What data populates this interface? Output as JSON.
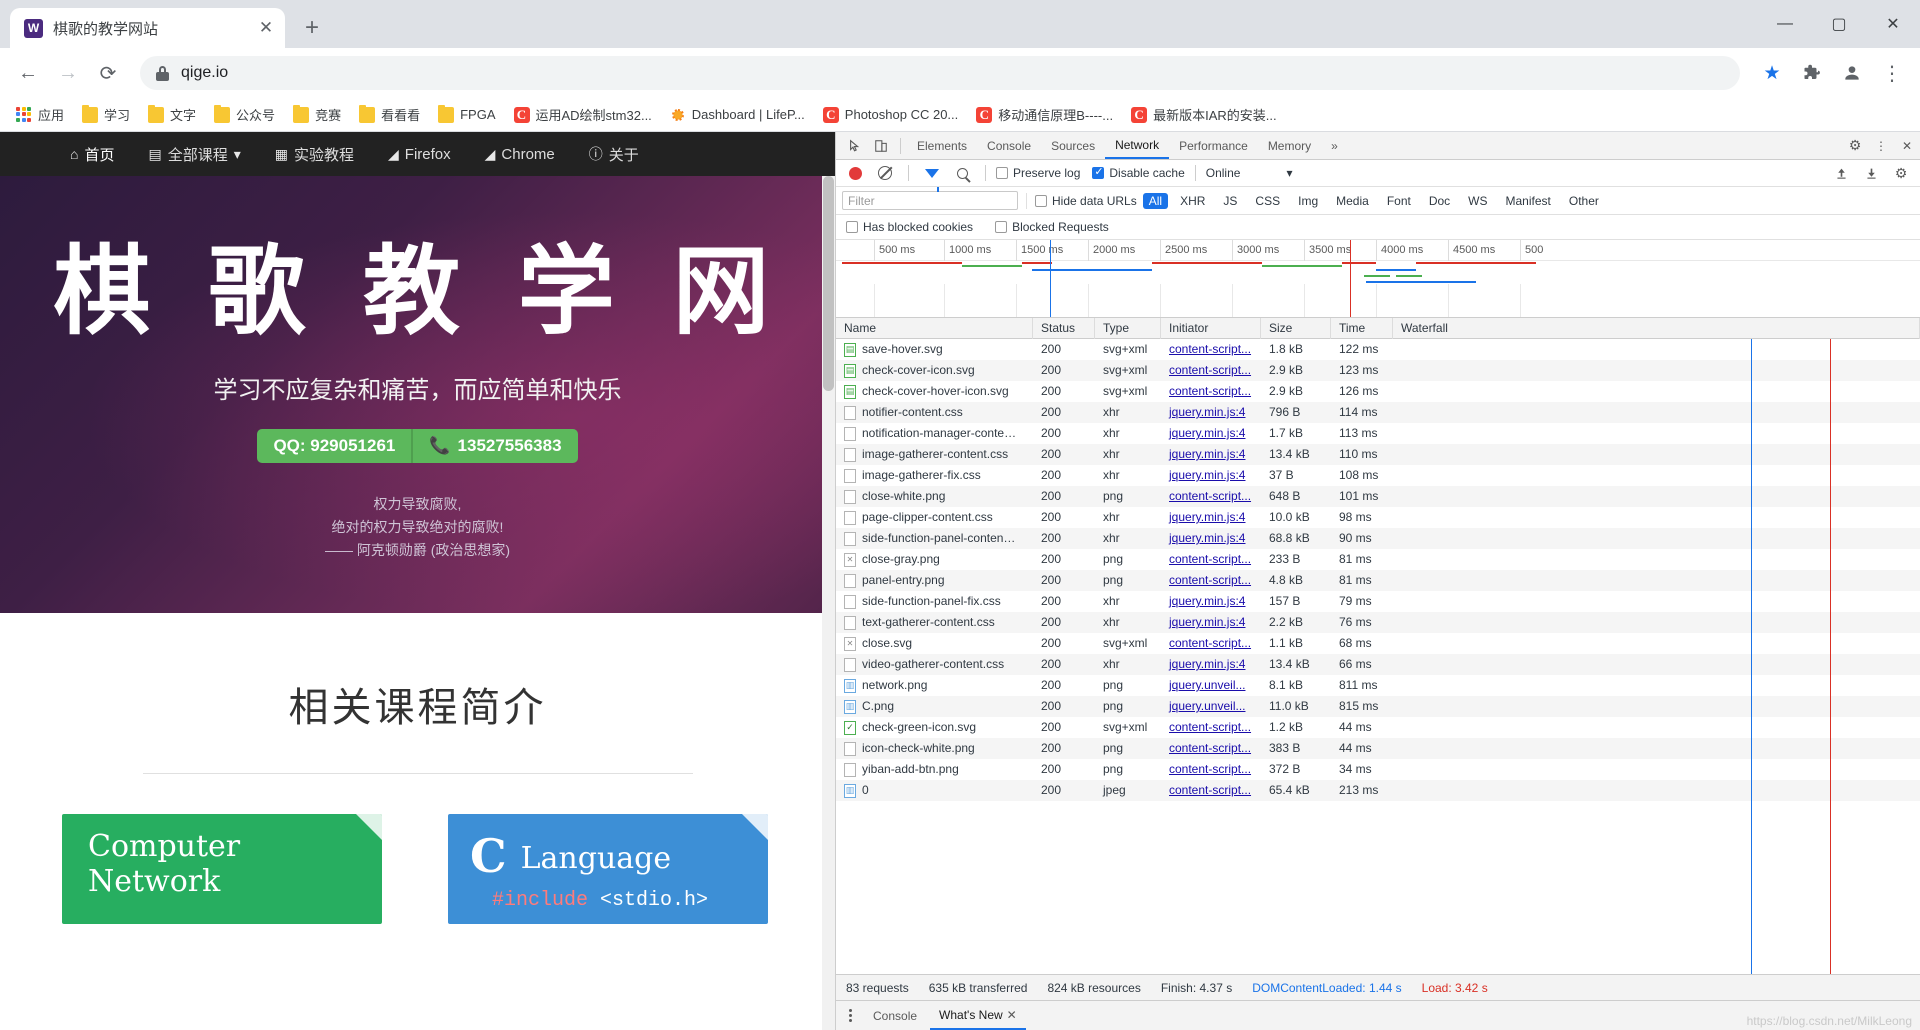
{
  "browser": {
    "tab": {
      "title": "棋歌的教学网站",
      "favicon_letter": "W",
      "close_label": "✕"
    },
    "newtab_label": "+",
    "window_controls": {
      "minimize": "—",
      "maximize": "▢",
      "close": "✕"
    },
    "nav": {
      "back": "←",
      "forward": "→",
      "reload": "⟳"
    },
    "omnibox": {
      "url": "qige.io",
      "lock_icon": "lock-icon",
      "star_icon": "bookmark-star-icon"
    },
    "toolbar_right": {
      "extensions": "🧩",
      "profile": "avatar",
      "menu": "⋮"
    },
    "bookmarks": [
      {
        "label": "应用",
        "icon": "apps-grid-icon"
      },
      {
        "label": "学习",
        "icon": "folder-icon"
      },
      {
        "label": "文字",
        "icon": "folder-icon"
      },
      {
        "label": "公众号",
        "icon": "folder-icon"
      },
      {
        "label": "竞赛",
        "icon": "folder-icon"
      },
      {
        "label": "看看看",
        "icon": "folder-icon"
      },
      {
        "label": "FPGA",
        "icon": "folder-icon"
      },
      {
        "label": "运用AD绘制stm32...",
        "icon": "csdn-icon"
      },
      {
        "label": "Dashboard | LifeP...",
        "icon": "sun-icon"
      },
      {
        "label": "Photoshop CC 20...",
        "icon": "csdn-icon"
      },
      {
        "label": "移动通信原理B----...",
        "icon": "csdn-icon"
      },
      {
        "label": "最新版本IAR的安装...",
        "icon": "csdn-icon"
      }
    ]
  },
  "site": {
    "nav": [
      {
        "label": "首页",
        "icon": "home-icon"
      },
      {
        "label": "全部课程",
        "icon": "book-icon",
        "caret": "▾"
      },
      {
        "label": "实验教程",
        "icon": "grid-icon"
      },
      {
        "label": "Firefox",
        "icon": "firefox-icon"
      },
      {
        "label": "Chrome",
        "icon": "chrome-icon"
      },
      {
        "label": "关于",
        "icon": "info-icon"
      }
    ],
    "hero": {
      "title": "棋 歌 教 学 网",
      "subtitle": "学习不应复杂和痛苦，而应简单和快乐",
      "qq_badge": "QQ: 929051261",
      "phone_badge": "13527556383",
      "phone_icon": "phone-icon",
      "quote_line1": "权力导致腐败,",
      "quote_line2": "绝对的权力导致绝对的腐败!",
      "quote_author": "—— 阿克顿勋爵 (政治思想家)"
    },
    "section_title": "相关课程简介",
    "cards": [
      {
        "line1": "Computer",
        "line2": "Network",
        "color": "#27ae60"
      },
      {
        "letter": "C",
        "title": "Language",
        "code_kw": "#include",
        "code_rest": " <stdio.h>",
        "color": "#3d8fd6"
      }
    ]
  },
  "devtools": {
    "tabs": [
      {
        "label": "Elements",
        "active": false
      },
      {
        "label": "Console",
        "active": false
      },
      {
        "label": "Sources",
        "active": false
      },
      {
        "label": "Network",
        "active": true
      },
      {
        "label": "Performance",
        "active": false
      },
      {
        "label": "Memory",
        "active": false
      }
    ],
    "more_label": "»",
    "icons": {
      "inspect": "inspect-element-icon",
      "device": "device-toolbar-icon",
      "settings": "gear-icon",
      "kebab": "more-options-icon",
      "close": "close-icon"
    },
    "toolbar": {
      "record_label": "record-button",
      "clear_label": "clear-button",
      "filter_toggle": "filter-icon",
      "search_toggle": "search-icon",
      "preserve_log": "Preserve log",
      "preserve_log_checked": false,
      "disable_cache": "Disable cache",
      "disable_cache_checked": true,
      "throttle_value": "Online",
      "throttle_caret": "▾",
      "import_icon": "import-har-icon",
      "export_icon": "export-har-icon"
    },
    "filterbar": {
      "filter_placeholder": "Filter",
      "hide_data_urls": "Hide data URLs",
      "hide_data_urls_checked": false,
      "types": [
        "All",
        "XHR",
        "JS",
        "CSS",
        "Img",
        "Media",
        "Font",
        "Doc",
        "WS",
        "Manifest",
        "Other"
      ],
      "active_type": "All"
    },
    "blockedbar": {
      "has_blocked_cookies": "Has blocked cookies",
      "has_blocked_cookies_checked": false,
      "blocked_requests": "Blocked Requests",
      "blocked_requests_checked": false
    },
    "overview_ticks": [
      "500 ms",
      "1000 ms",
      "1500 ms",
      "2000 ms",
      "2500 ms",
      "3000 ms",
      "3500 ms",
      "4000 ms",
      "4500 ms",
      "500"
    ],
    "columns": [
      "Name",
      "Status",
      "Type",
      "Initiator",
      "Size",
      "Time",
      "Waterfall"
    ],
    "rows": [
      {
        "name": "save-hover.svg",
        "icon": "svg-file-icon",
        "status": "200",
        "type": "svg+xml",
        "initiator": "content-script...",
        "size": "1.8 kB",
        "time": "122 ms"
      },
      {
        "name": "check-cover-icon.svg",
        "icon": "svg-file-icon",
        "status": "200",
        "type": "svg+xml",
        "initiator": "content-script...",
        "size": "2.9 kB",
        "time": "123 ms"
      },
      {
        "name": "check-cover-hover-icon.svg",
        "icon": "svg-file-icon",
        "status": "200",
        "type": "svg+xml",
        "initiator": "content-script...",
        "size": "2.9 kB",
        "time": "126 ms"
      },
      {
        "name": "notifier-content.css",
        "icon": "file-icon",
        "status": "200",
        "type": "xhr",
        "initiator": "jquery.min.js:4",
        "size": "796 B",
        "time": "114 ms"
      },
      {
        "name": "notification-manager-conte…",
        "icon": "file-icon",
        "status": "200",
        "type": "xhr",
        "initiator": "jquery.min.js:4",
        "size": "1.7 kB",
        "time": "113 ms"
      },
      {
        "name": "image-gatherer-content.css",
        "icon": "file-icon",
        "status": "200",
        "type": "xhr",
        "initiator": "jquery.min.js:4",
        "size": "13.4 kB",
        "time": "110 ms"
      },
      {
        "name": "image-gatherer-fix.css",
        "icon": "file-icon",
        "status": "200",
        "type": "xhr",
        "initiator": "jquery.min.js:4",
        "size": "37 B",
        "time": "108 ms"
      },
      {
        "name": "close-white.png",
        "icon": "file-icon",
        "status": "200",
        "type": "png",
        "initiator": "content-script...",
        "size": "648 B",
        "time": "101 ms"
      },
      {
        "name": "page-clipper-content.css",
        "icon": "file-icon",
        "status": "200",
        "type": "xhr",
        "initiator": "jquery.min.js:4",
        "size": "10.0 kB",
        "time": "98 ms"
      },
      {
        "name": "side-function-panel-conten…",
        "icon": "file-icon",
        "status": "200",
        "type": "xhr",
        "initiator": "jquery.min.js:4",
        "size": "68.8 kB",
        "time": "90 ms"
      },
      {
        "name": "close-gray.png",
        "icon": "image-broken-icon",
        "status": "200",
        "type": "png",
        "initiator": "content-script...",
        "size": "233 B",
        "time": "81 ms"
      },
      {
        "name": "panel-entry.png",
        "icon": "file-icon",
        "status": "200",
        "type": "png",
        "initiator": "content-script...",
        "size": "4.8 kB",
        "time": "81 ms"
      },
      {
        "name": "side-function-panel-fix.css",
        "icon": "file-icon",
        "status": "200",
        "type": "xhr",
        "initiator": "jquery.min.js:4",
        "size": "157 B",
        "time": "79 ms"
      },
      {
        "name": "text-gatherer-content.css",
        "icon": "file-icon",
        "status": "200",
        "type": "xhr",
        "initiator": "jquery.min.js:4",
        "size": "2.2 kB",
        "time": "76 ms"
      },
      {
        "name": "close.svg",
        "icon": "image-broken-icon",
        "status": "200",
        "type": "svg+xml",
        "initiator": "content-script...",
        "size": "1.1 kB",
        "time": "68 ms"
      },
      {
        "name": "video-gatherer-content.css",
        "icon": "file-icon",
        "status": "200",
        "type": "xhr",
        "initiator": "jquery.min.js:4",
        "size": "13.4 kB",
        "time": "66 ms"
      },
      {
        "name": "network.png",
        "icon": "image-file-icon",
        "status": "200",
        "type": "png",
        "initiator": "jquery.unveil...",
        "size": "8.1 kB",
        "time": "811 ms"
      },
      {
        "name": "C.png",
        "icon": "image-file-icon",
        "status": "200",
        "type": "png",
        "initiator": "jquery.unveil...",
        "size": "11.0 kB",
        "time": "815 ms"
      },
      {
        "name": "check-green-icon.svg",
        "icon": "check-green-icon",
        "status": "200",
        "type": "svg+xml",
        "initiator": "content-script...",
        "size": "1.2 kB",
        "time": "44 ms"
      },
      {
        "name": "icon-check-white.png",
        "icon": "file-icon",
        "status": "200",
        "type": "png",
        "initiator": "content-script...",
        "size": "383 B",
        "time": "44 ms"
      },
      {
        "name": "yiban-add-btn.png",
        "icon": "file-icon",
        "status": "200",
        "type": "png",
        "initiator": "content-script...",
        "size": "372 B",
        "time": "34 ms"
      },
      {
        "name": "0",
        "icon": "image-file-icon",
        "status": "200",
        "type": "jpeg",
        "initiator": "content-script...",
        "size": "65.4 kB",
        "time": "213 ms"
      }
    ],
    "status": {
      "requests": "83 requests",
      "transferred": "635 kB transferred",
      "resources": "824 kB resources",
      "finish": "Finish: 4.37 s",
      "dom_loaded": "DOMContentLoaded: 1.44 s",
      "load": "Load: 3.42 s"
    },
    "drawer": {
      "tabs": [
        {
          "label": "Console",
          "active": false
        },
        {
          "label": "What's New",
          "active": true
        }
      ],
      "close": "✕",
      "watermark": "https://blog.csdn.net/MilkLeong"
    }
  }
}
